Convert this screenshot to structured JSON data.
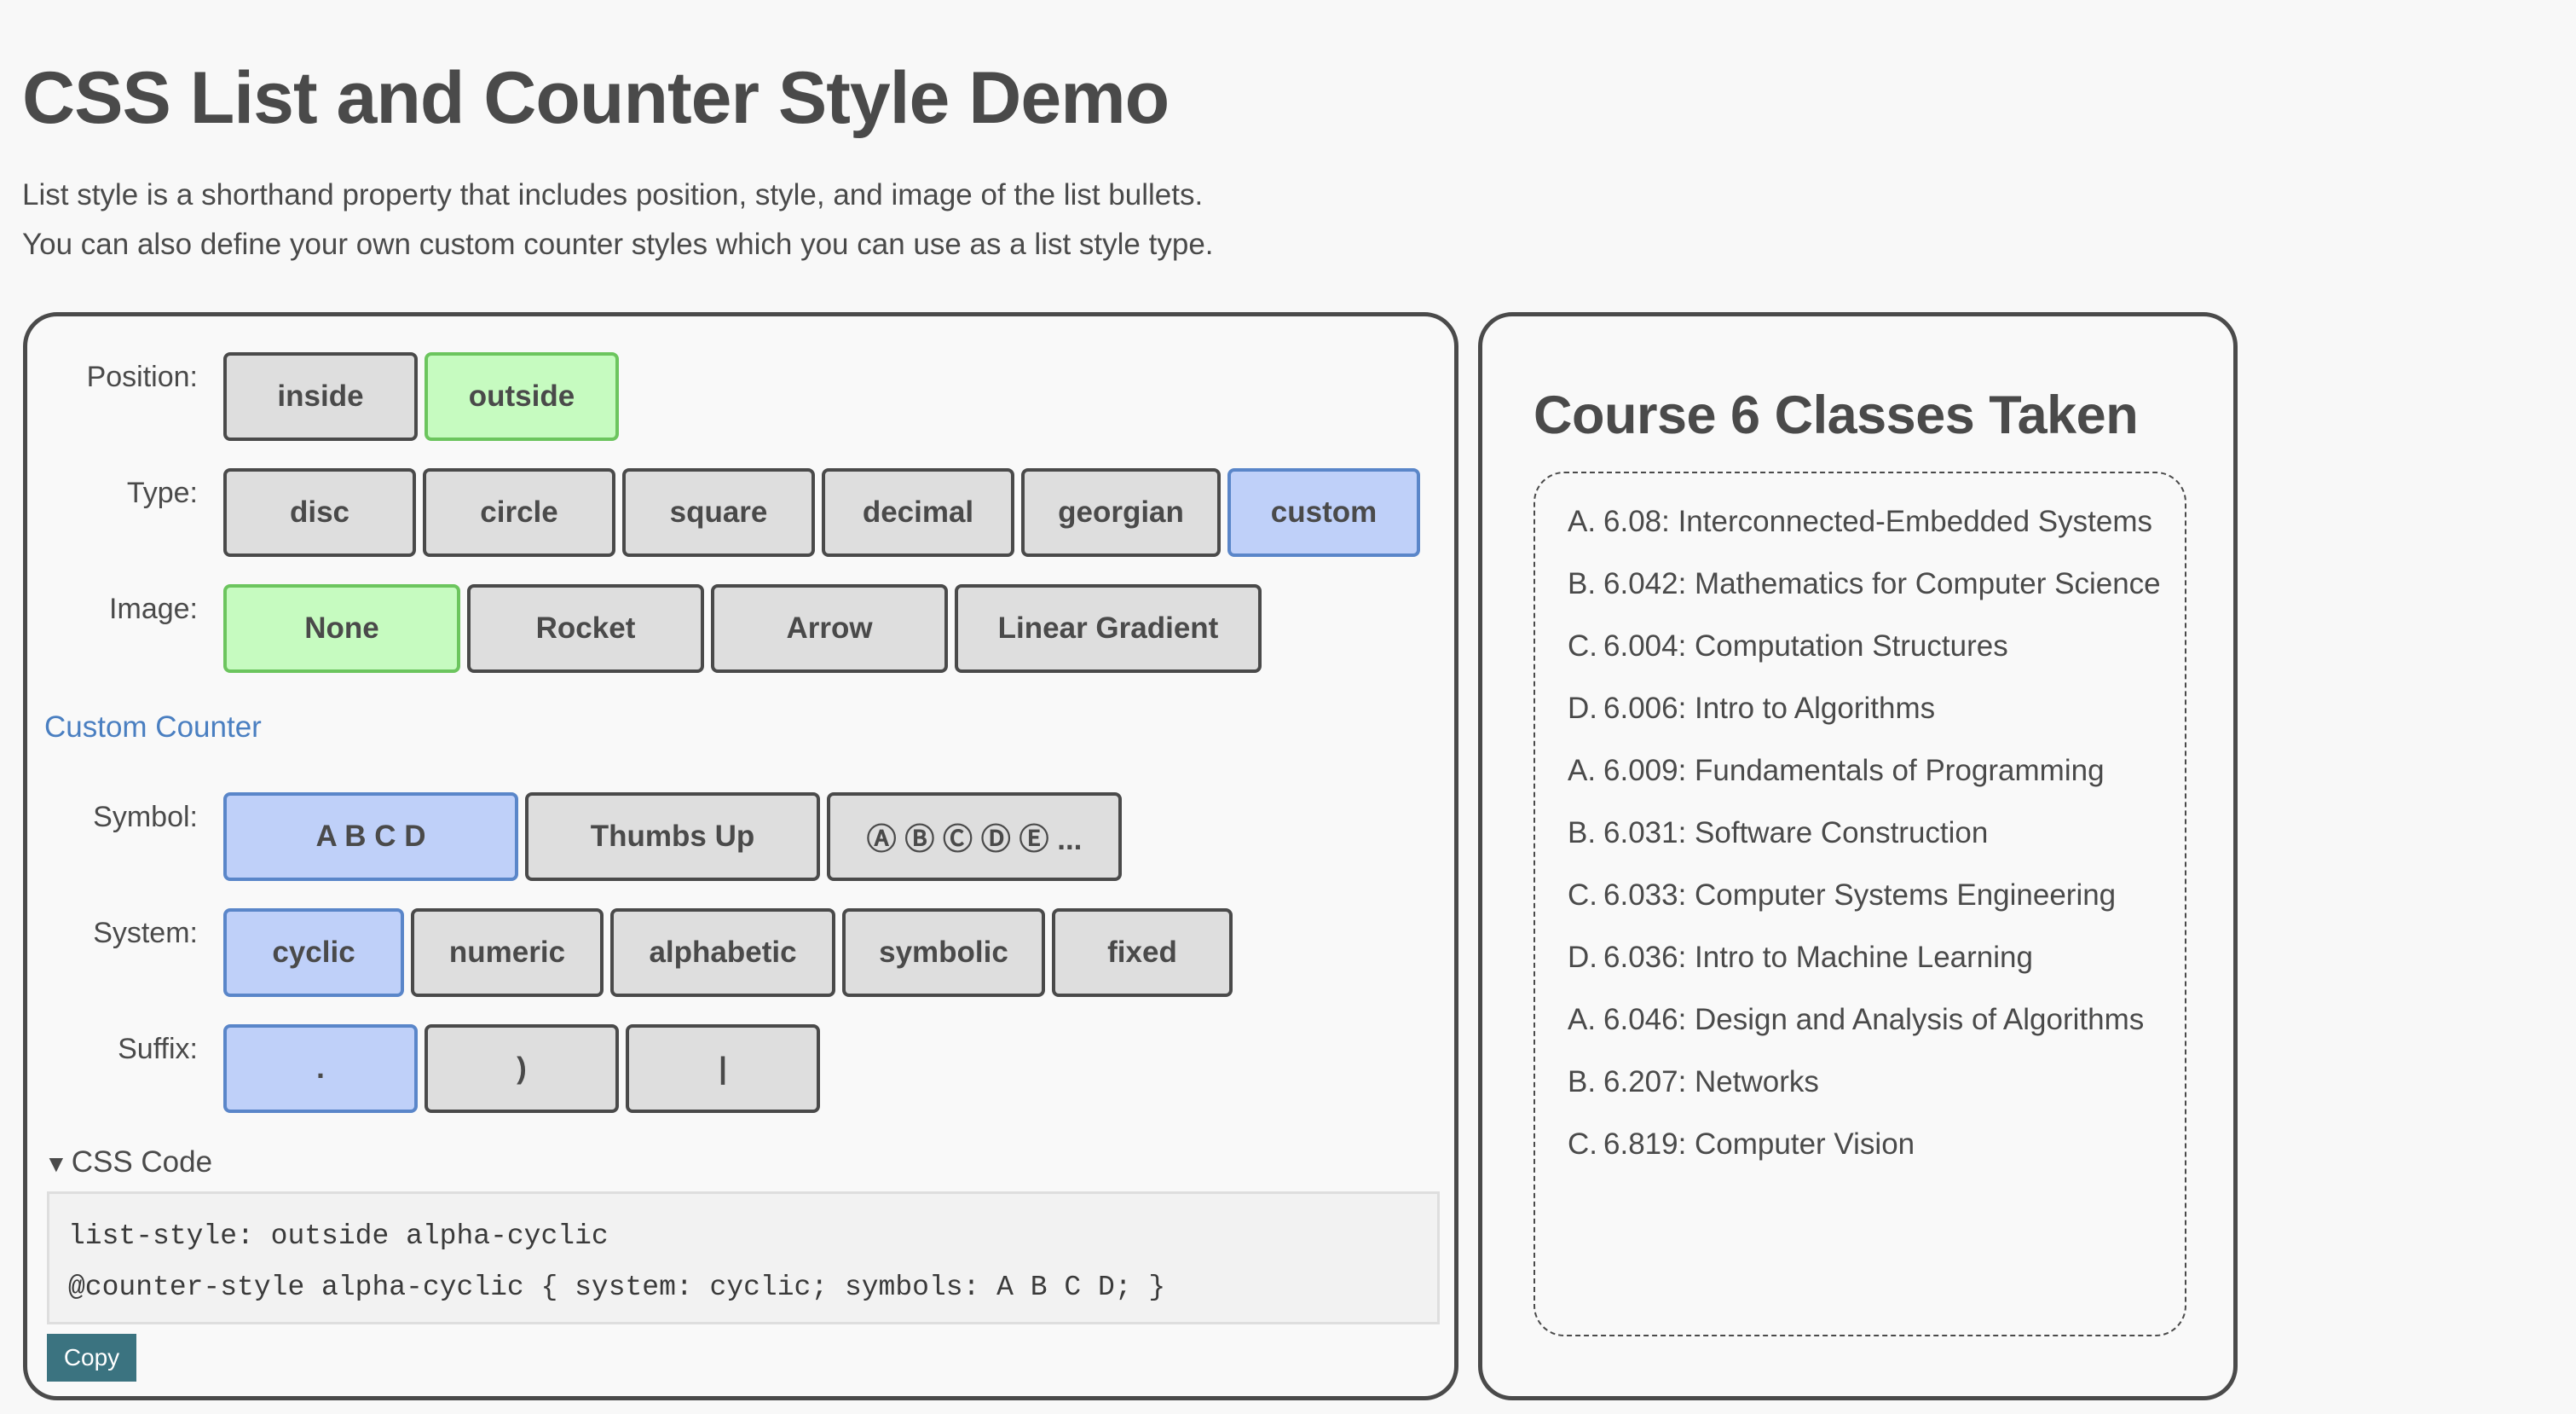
{
  "page": {
    "title": "CSS List and Counter Style Demo",
    "intro_lines": [
      "List style is a shorthand property that includes position, style, and image of the list bullets.",
      "You can also define your own custom counter styles which you can use as a list style type."
    ]
  },
  "controls": {
    "position": {
      "label": "Position:",
      "options": [
        "inside",
        "outside"
      ],
      "selected": "outside"
    },
    "type": {
      "label": "Type:",
      "options": [
        "disc",
        "circle",
        "square",
        "decimal",
        "georgian",
        "custom"
      ],
      "selected": "custom"
    },
    "image": {
      "label": "Image:",
      "options": [
        "None",
        "Rocket",
        "Arrow",
        "Linear Gradient"
      ],
      "selected": "None"
    },
    "custom_counter_link": "Custom Counter",
    "symbol": {
      "label": "Symbol:",
      "options": [
        "A B C D",
        "Thumbs Up",
        "Ⓐ Ⓑ Ⓒ Ⓓ Ⓔ ..."
      ],
      "selected": "A B C D"
    },
    "system": {
      "label": "System:",
      "options": [
        "cyclic",
        "numeric",
        "alphabetic",
        "symbolic",
        "fixed"
      ],
      "selected": "cyclic"
    },
    "suffix": {
      "label": "Suffix:",
      "options": [
        ".",
        ")",
        "|"
      ],
      "selected": "."
    }
  },
  "css_code": {
    "summary": "CSS Code",
    "lines": [
      "list-style: outside alpha-cyclic",
      "@counter-style alpha-cyclic { system: cyclic; symbols: A B C D; }"
    ],
    "copy_label": "Copy"
  },
  "courses": {
    "title": "Course 6 Classes Taken",
    "items": [
      {
        "marker": "A.",
        "text": "6.08: Interconnected-Embedded Systems"
      },
      {
        "marker": "B.",
        "text": "6.042: Mathematics for Computer Science"
      },
      {
        "marker": "C.",
        "text": "6.004: Computation Structures"
      },
      {
        "marker": "D.",
        "text": "6.006: Intro to Algorithms"
      },
      {
        "marker": "A.",
        "text": "6.009: Fundamentals of Programming"
      },
      {
        "marker": "B.",
        "text": "6.031: Software Construction"
      },
      {
        "marker": "C.",
        "text": "6.033: Computer Systems Engineering"
      },
      {
        "marker": "D.",
        "text": "6.036: Intro to Machine Learning"
      },
      {
        "marker": "A.",
        "text": "6.046: Design and Analysis of Algorithms"
      },
      {
        "marker": "B.",
        "text": "6.207: Networks"
      },
      {
        "marker": "C.",
        "text": "6.819: Computer Vision"
      }
    ]
  },
  "colors": {
    "selected_green_bg": "#c6fbc0",
    "selected_green_border": "#6cc55e",
    "selected_blue_bg": "#bfd0f9",
    "selected_blue_border": "#5a86c9",
    "link": "#4a7fc1",
    "copy_button": "#3b7380"
  }
}
